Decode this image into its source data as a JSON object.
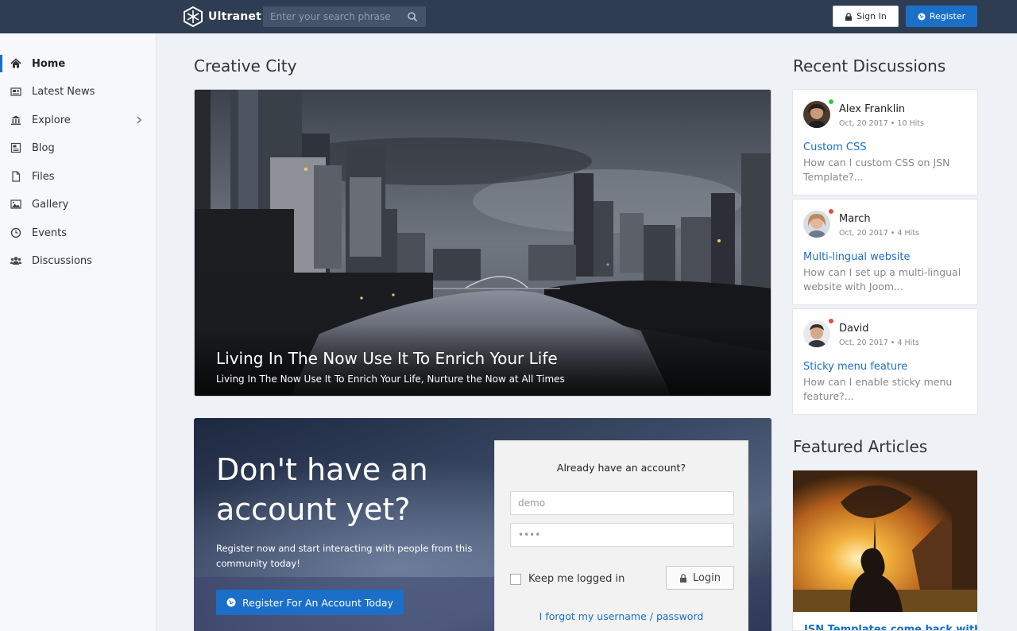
{
  "header": {
    "brand": "Ultranet",
    "search_placeholder": "Enter your search phrase",
    "signin_label": "Sign In",
    "register_label": "Register"
  },
  "sidebar": {
    "items": [
      {
        "label": "Home",
        "icon": "home-icon",
        "active": true
      },
      {
        "label": "Latest News",
        "icon": "newspaper-icon"
      },
      {
        "label": "Explore",
        "icon": "bank-icon",
        "has_submenu": true
      },
      {
        "label": "Blog",
        "icon": "blog-icon"
      },
      {
        "label": "Files",
        "icon": "file-icon"
      },
      {
        "label": "Gallery",
        "icon": "image-icon"
      },
      {
        "label": "Events",
        "icon": "clock-icon"
      },
      {
        "label": "Discussions",
        "icon": "users-icon"
      }
    ]
  },
  "main": {
    "section_title": "Creative City",
    "hero": {
      "title": "Living In The Now Use It To Enrich Your Life",
      "subtitle": "Living In The Now Use It To Enrich Your Life,  Nurture the Now at All Times"
    },
    "promo": {
      "heading": "Don't have an account yet?",
      "text": "Register now and start interacting with people from this community today!",
      "button_label": "Register For An Account Today"
    },
    "login": {
      "title": "Already have an account?",
      "username_value": "demo",
      "password_value": "demo",
      "remember_label": "Keep me logged in",
      "login_label": "Login",
      "forgot_label": "I forgot my username / password"
    }
  },
  "right": {
    "discussions_title": "Recent Discussions",
    "discussions": [
      {
        "name": "Alex Franklin",
        "meta": "Oct, 20 2017 • 10 Hits",
        "title": "Custom CSS",
        "excerpt": "How can I custom CSS on JSN Template?...",
        "status_color": "#2ecc40"
      },
      {
        "name": "March",
        "meta": "Oct, 20 2017 • 4 Hits",
        "title": "Multi-lingual website",
        "excerpt": "How can I set up a multi-lingual website with Joom...",
        "status_color": "#e74c3c"
      },
      {
        "name": "David",
        "meta": "Oct, 20 2017 • 4 Hits",
        "title": "Sticky menu feature",
        "excerpt": "How can I enable sticky menu feature?...",
        "status_color": "#e74c3c"
      }
    ],
    "featured_title": "Featured Articles",
    "featured_article_title": "JSN Templates come back with"
  },
  "colors": {
    "topbar": "#2f3d52",
    "accent": "#1b6fc9",
    "sidebar_bg": "#f6f8fb",
    "page_bg": "#eef1f5"
  }
}
